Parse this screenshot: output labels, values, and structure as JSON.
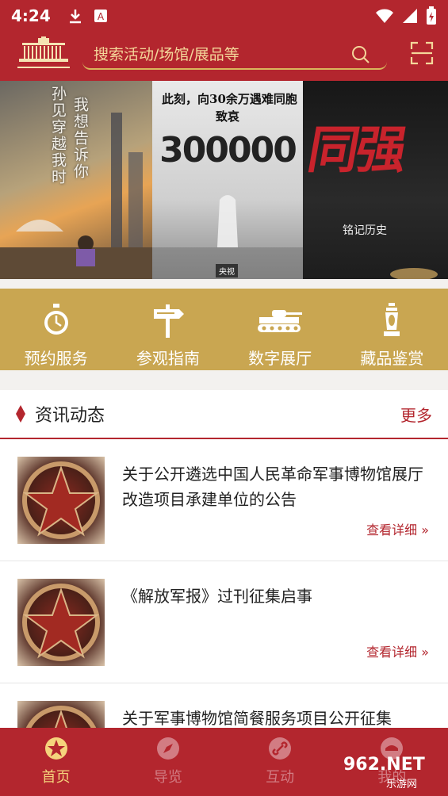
{
  "status_bar": {
    "time": "4:24"
  },
  "header": {
    "search_placeholder": "搜索活动/场馆/展品等"
  },
  "banner": {
    "panel1_text_a": "孙见穿越我时",
    "panel1_text_b": "我想告诉你",
    "panel2_headline": "此刻，向30余万遇难同胞",
    "panel2_sub": "致哀",
    "panel2_number": "300000",
    "panel2_badge": "央视",
    "panel3_callig": "同强",
    "panel3_small": "铭记历史",
    "active_index": 0,
    "dot_count": 6
  },
  "quick_links": [
    {
      "label": "预约服务",
      "icon": "stopwatch-icon"
    },
    {
      "label": "参观指南",
      "icon": "signpost-icon"
    },
    {
      "label": "数字展厅",
      "icon": "tank-icon"
    },
    {
      "label": "藏品鉴赏",
      "icon": "lantern-icon"
    }
  ],
  "news": {
    "title": "资讯动态",
    "more": "更多",
    "items": [
      {
        "title": "关于公开遴选中国人民革命军事博物馆展厅改造项目承建单位的公告",
        "detail": "查看详细 »"
      },
      {
        "title": "《解放军报》过刊征集启事",
        "detail": "查看详细 »"
      },
      {
        "title": "关于军事博物馆简餐服务项目公开征集",
        "detail": ""
      }
    ]
  },
  "tabs": [
    {
      "label": "首页",
      "active": true
    },
    {
      "label": "导览",
      "active": false
    },
    {
      "label": "互动",
      "active": false
    },
    {
      "label": "我的",
      "active": false
    }
  ],
  "watermark": {
    "text": "962.NET",
    "sub": "乐游网"
  },
  "colors": {
    "primary": "#b3262e",
    "gold": "#c9a651",
    "accent": "#e25c12"
  }
}
